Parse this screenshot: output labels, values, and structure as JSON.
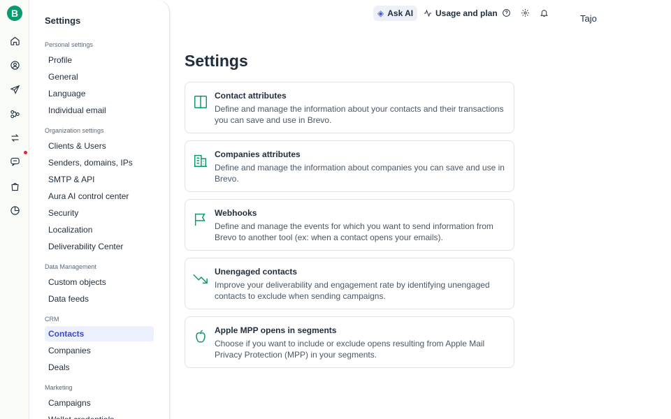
{
  "rail": {
    "logo_letter": "B",
    "icons": [
      "home-icon",
      "contacts-icon",
      "campaigns-send-icon",
      "automations-icon",
      "transactional-icon",
      "conversations-icon",
      "ecommerce-icon",
      "meetings-icon"
    ]
  },
  "sidepanel": {
    "title": "Settings",
    "sections": [
      {
        "label": "Personal settings",
        "items": [
          "Profile",
          "General",
          "Language",
          "Individual email"
        ]
      },
      {
        "label": "Organization settings",
        "items": [
          "Clients & Users",
          "Senders, domains, IPs",
          "SMTP & API",
          "Aura AI control center",
          "Security",
          "Localization",
          "Deliverability Center"
        ]
      },
      {
        "label": "Data Management",
        "items": [
          "Custom objects",
          "Data feeds"
        ]
      },
      {
        "label": "CRM",
        "items": [
          "Contacts",
          "Companies",
          "Deals"
        ]
      },
      {
        "label": "Marketing",
        "items": [
          "Campaigns",
          "Wallet credentials"
        ]
      }
    ],
    "active_item": "Contacts"
  },
  "topbar": {
    "ask_ai": "Ask AI",
    "usage": "Usage and plan",
    "user_name": "Tajo"
  },
  "main": {
    "title": "Settings",
    "cards": [
      {
        "title": "Contact attributes",
        "desc": "Define and manage the information about your contacts and their transactions you can save and use in Brevo.",
        "icon": "columns-icon"
      },
      {
        "title": "Companies attributes",
        "desc": "Define and manage the information about companies you can save and use in Brevo.",
        "icon": "building-icon"
      },
      {
        "title": "Webhooks",
        "desc": "Define and manage the events for which you want to send information from Brevo to another tool (ex: when a contact opens your emails).",
        "icon": "flag-icon"
      },
      {
        "title": "Unengaged contacts",
        "desc": "Improve your deliverability and engagement rate by identifying unengaged contacts to exclude when sending campaigns.",
        "icon": "trending-down-icon"
      },
      {
        "title": "Apple MPP opens in segments",
        "desc": "Choose if you want to include or exclude opens resulting from Apple Mail Privacy Protection (MPP) in your segments.",
        "icon": "apple-icon"
      }
    ]
  },
  "colors": {
    "brand": "#0b996e",
    "active_bg": "#eceffd",
    "active_text": "#3b4bc4",
    "notification": "#e3243b"
  }
}
